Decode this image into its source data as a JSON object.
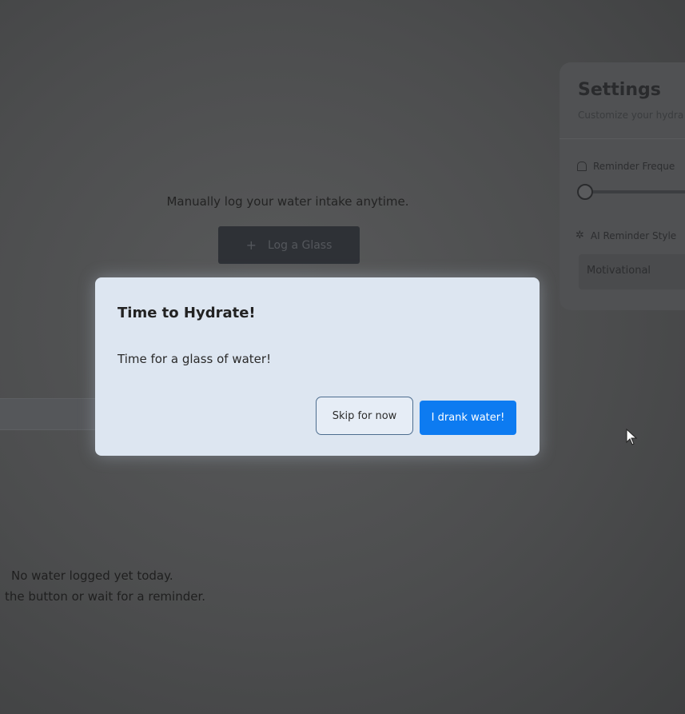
{
  "main": {
    "log_caption": "Manually log your water intake anytime.",
    "log_button_label": "Log a Glass",
    "log_button_icon": "plus-icon",
    "empty_line1": "No water logged yet today.",
    "empty_line2": "the button or wait for a reminder."
  },
  "settings": {
    "title": "Settings",
    "subtitle": "Customize your hydra",
    "reminder_frequency_label": "Reminder Freque",
    "reminder_frequency_icon": "bell-icon",
    "ai_style_label": "AI Reminder Style",
    "ai_style_icon": "sparkle-icon",
    "ai_style_value": "Motivational"
  },
  "modal": {
    "title": "Time to Hydrate!",
    "message": "Time for a glass of water!",
    "skip_label": "Skip for now",
    "drank_label": "I drank water!",
    "accent_color": "#0d7bf1"
  }
}
